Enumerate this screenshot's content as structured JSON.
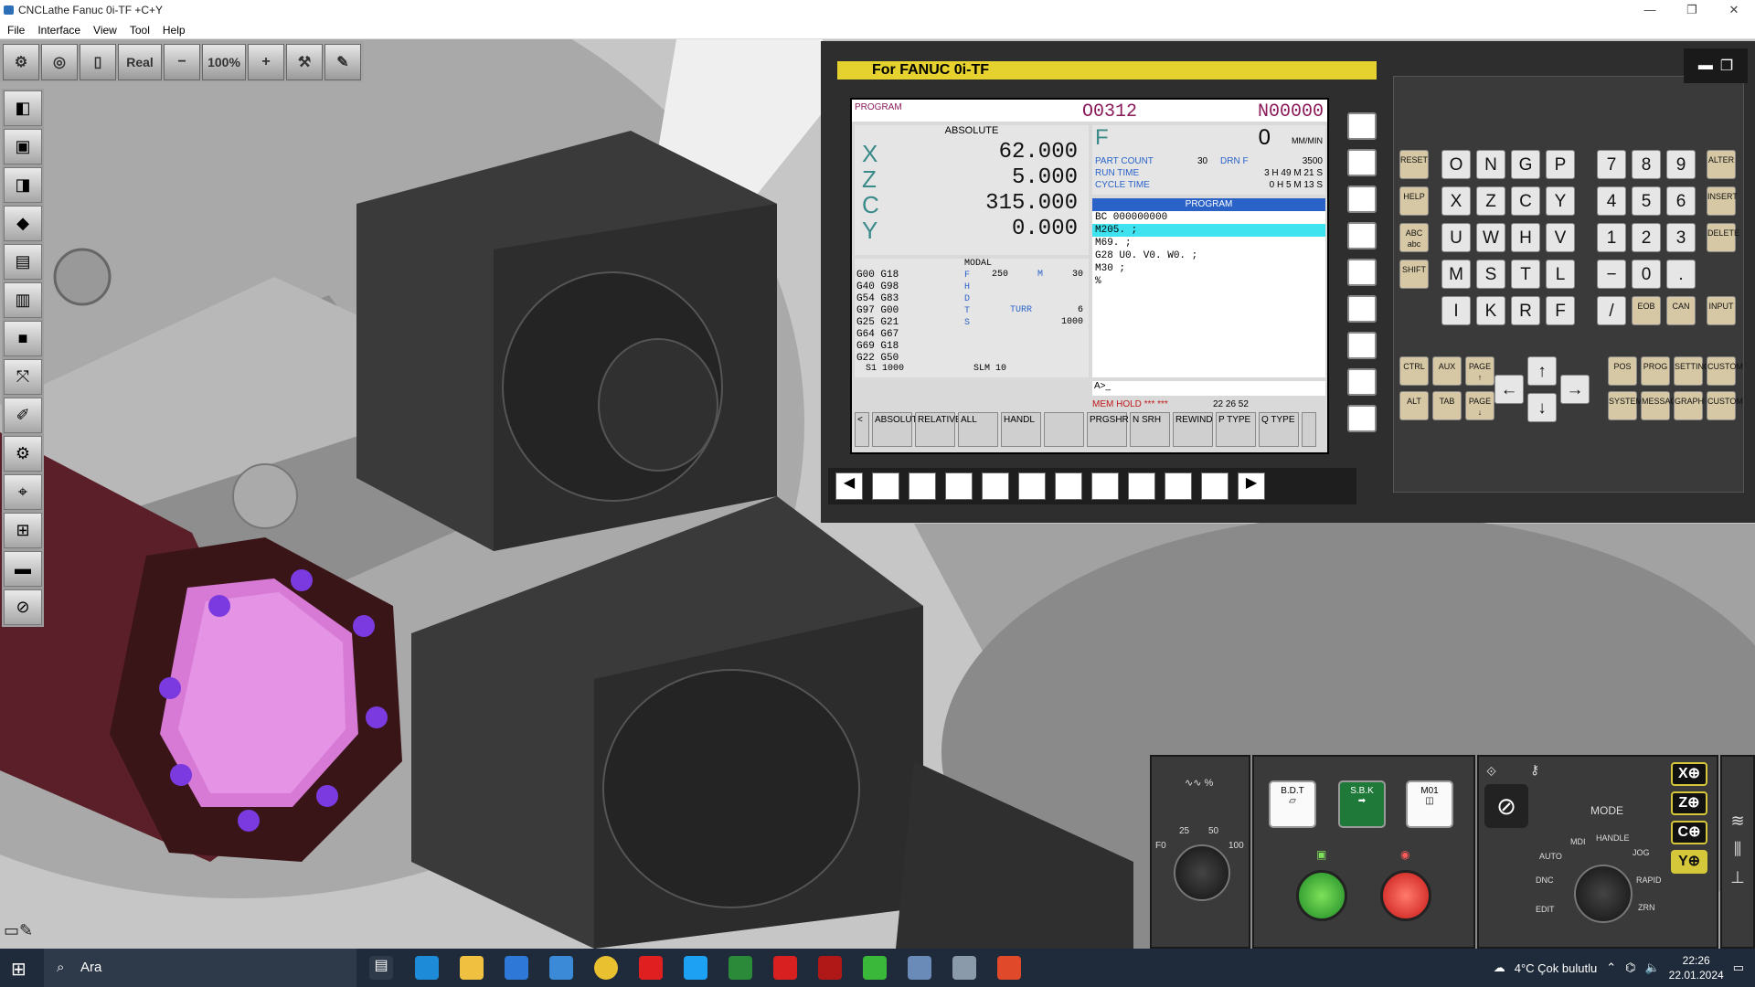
{
  "window": {
    "title": "CNCLathe Fanuc 0i-TF +C+Y",
    "min": "—",
    "max": "❐",
    "close": "✕"
  },
  "menu": [
    "File",
    "Interface",
    "View",
    "Tool",
    "Help"
  ],
  "toolbar": {
    "real": "Real",
    "minus": "−",
    "zoom": "100%",
    "plus": "+"
  },
  "cnc": {
    "title": "For FANUC 0i-TF",
    "mode_label": "PROGRAM",
    "prog_no": "O0312",
    "seq_no": "N00000",
    "abs_label": "ABSOLUTE",
    "axes": [
      {
        "n": "X",
        "v": "62.000"
      },
      {
        "n": "Z",
        "v": "5.000"
      },
      {
        "n": "C",
        "v": "315.000"
      },
      {
        "n": "Y",
        "v": "0.000"
      }
    ],
    "feed_label": "F",
    "feed_value": "0",
    "feed_unit": "MM/MIN",
    "part_count_label": "PART COUNT",
    "part_count": "30",
    "drn_label": "DRN F",
    "drn_value": "3500",
    "run_time_label": "RUN TIME",
    "run_time": "3 H 49 M 21 S",
    "cycle_time_label": "CYCLE TIME",
    "cycle_time": "0 H 5 M 13 S",
    "prog_header": "PROGRAM",
    "program_lines": [
      "BC 000000000",
      "M205. ;",
      "M69. ;",
      "G28 U0. V0. W0. ;",
      "M30 ;",
      "%"
    ],
    "modal_label": "MODAL",
    "modal_rows": [
      "G00  G18",
      "G40  G98",
      "G54  G83",
      "G97  G00",
      "G25  G21",
      "G64  G67",
      "G69  G18",
      "G22  G50"
    ],
    "modal_right": [
      {
        "k": "F",
        "v": "250",
        "k2": "M",
        "v2": "30"
      },
      {
        "k": "H",
        "v": ""
      },
      {
        "k": "D",
        "v": ""
      },
      {
        "k": "T",
        "v": "",
        "k2": "TURR",
        "v2": "6"
      },
      {
        "k": "S",
        "v": "",
        "v2": "1000"
      }
    ],
    "s1": "S1   1000",
    "slm": "SLM  10",
    "input_prompt": "A>_",
    "status": "MEM HOLD *** ***",
    "time": "22 26 52",
    "softkeys": [
      "<",
      "ABSOLUTE",
      "RELATIVE",
      "ALL",
      "HANDL",
      "",
      "PRGSHR",
      "N SRH",
      "REWIND",
      "P TYPE",
      "Q TYPE",
      ""
    ]
  },
  "keys": {
    "letters": [
      "O",
      "N",
      "G",
      "P",
      "X",
      "Z",
      "C",
      "Y",
      "U",
      "W",
      "H",
      "V",
      "M",
      "S",
      "T",
      "L",
      "I",
      "K",
      "R",
      "F"
    ],
    "numbers": [
      "7",
      "8",
      "9",
      "4",
      "5",
      "6",
      "1",
      "2",
      "3",
      "−",
      "0",
      "."
    ],
    "func_left": [
      "RESET",
      "HELP",
      "ABC abc",
      "SHIFT"
    ],
    "func_right": [
      "ALTER",
      "INSERT",
      "DELETE",
      "INPUT"
    ],
    "eob": "EOB",
    "can": "CAN",
    "slash": "/",
    "bottom": [
      "CTRL",
      "AUX",
      "PAGE ↑",
      "ALT",
      "TAB",
      "PAGE ↓",
      "POS",
      "PROG",
      "SETTING",
      "CUSTOM",
      "SYSTEM",
      "MESSAGE",
      "GRAPH",
      "CUSTOM"
    ]
  },
  "panel": {
    "feed_override": "%",
    "ticks": [
      "25",
      "50",
      "F0",
      "100"
    ],
    "bdt": "B.D.T",
    "sbk": "S.B.K",
    "m01": "M01",
    "mode_label": "MODE",
    "mode_labels": [
      "AUTO",
      "MDI",
      "HANDLE",
      "JOG",
      "RAPID",
      "DNC",
      "EDIT",
      "ZRN"
    ],
    "axis_buttons": [
      "X⊕",
      "Z⊕",
      "C⊕",
      "Y⊕"
    ]
  },
  "taskbar": {
    "search": "Ara",
    "weather": "4°C  Çok bulutlu",
    "time": "22:26",
    "date": "22.01.2024"
  }
}
